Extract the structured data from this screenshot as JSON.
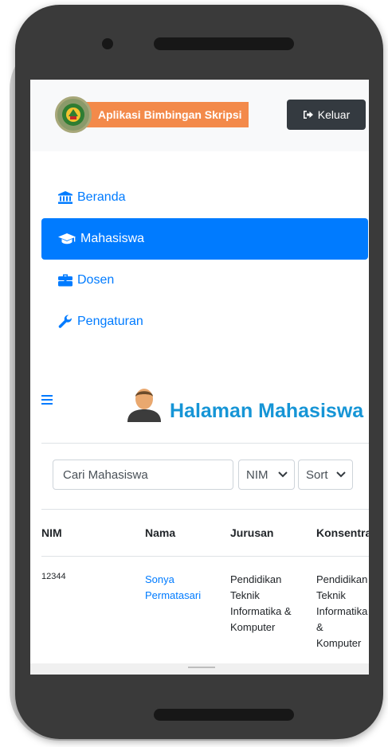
{
  "header": {
    "brand": "Aplikasi Bimbingan Skripsi",
    "logout_label": "Keluar"
  },
  "menu": {
    "items": [
      {
        "label": "Beranda",
        "icon": "institution-icon",
        "active": false
      },
      {
        "label": "Mahasiswa",
        "icon": "graduation-cap-icon",
        "active": true
      },
      {
        "label": "Dosen",
        "icon": "briefcase-icon",
        "active": false
      },
      {
        "label": "Pengaturan",
        "icon": "wrench-icon",
        "active": false
      }
    ]
  },
  "page": {
    "title": "Halaman Mahasiswa"
  },
  "search": {
    "placeholder": "Cari Mahasiswa",
    "filter_field": "NIM",
    "sort": "Sort"
  },
  "table": {
    "headers": [
      "NIM",
      "Nama",
      "Jurusan",
      "Konsentrasi"
    ],
    "rows": [
      {
        "nim": "12344",
        "nama": "Sonya Permatasari",
        "jurusan": "Pendidikan Teknik Informatika & Komputer",
        "konsentrasi": "Pendidikan Teknik Informatika & Komputer"
      }
    ]
  },
  "colors": {
    "primary": "#007bff",
    "brand_bg": "#f38a4a",
    "title": "#1695d6",
    "dark_button": "#343a40"
  }
}
